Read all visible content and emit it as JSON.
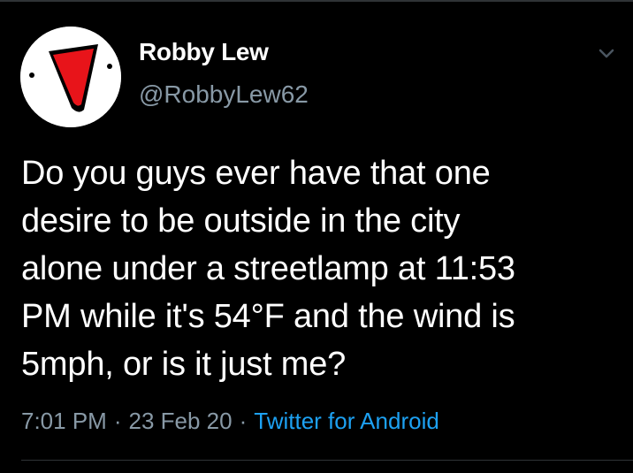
{
  "tweet": {
    "author": {
      "display_name": "Robby Lew",
      "handle": "@RobbyLew62",
      "avatar_icon": "red-triangle-face-avatar"
    },
    "text": "Do you guys ever have that one\ndesire to be outside in the city\nalone under a streetlamp at 11:53\nPM while it's 54°F and the wind is\n5mph, or is it just me?",
    "time": "7:01 PM",
    "separator": "·",
    "date": "23 Feb 20",
    "source": "Twitter for Android",
    "menu_icon": "chevron-down-icon"
  },
  "colors": {
    "background": "#000000",
    "primary_text": "#ffffff",
    "secondary_text": "#8899a6",
    "link": "#1da1f2",
    "divider": "#2f3336",
    "avatar_accent": "#e8141a"
  }
}
